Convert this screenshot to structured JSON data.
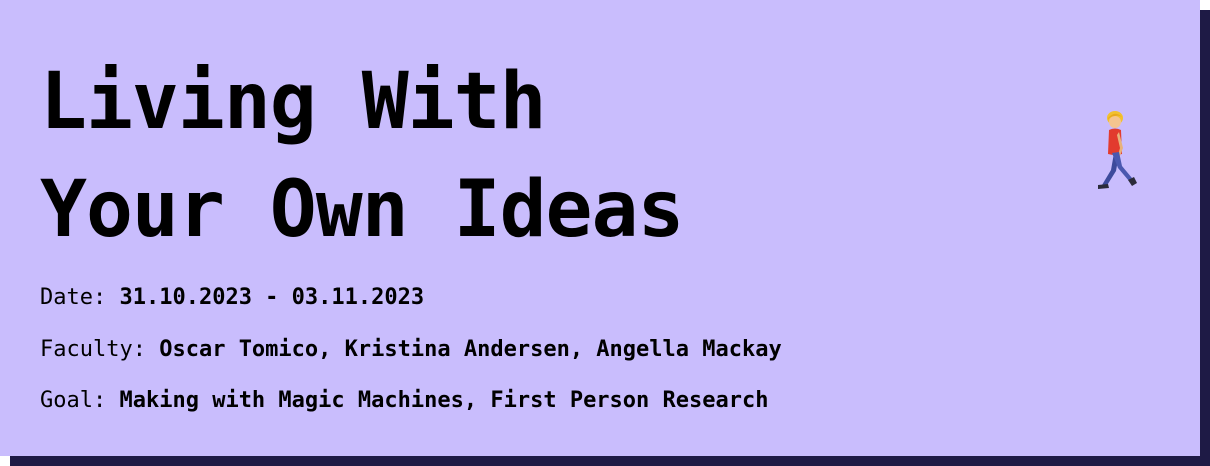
{
  "title": {
    "line1": "Living With",
    "line2": "Your Own Ideas"
  },
  "meta": {
    "date_label": "Date: ",
    "date_value": "31.10.2023 - 03.11.2023",
    "faculty_label": "Faculty: ",
    "faculty_value": "Oscar Tomico, Kristina Andersen, Angella Mackay",
    "goal_label": "Goal: ",
    "goal_value": "Making with Magic Machines, First Person Research"
  },
  "icon": {
    "name": "walking-person-icon"
  },
  "colors": {
    "card_background": "#c9bdfd",
    "card_shadow": "#1e1a45",
    "text": "#000000"
  }
}
